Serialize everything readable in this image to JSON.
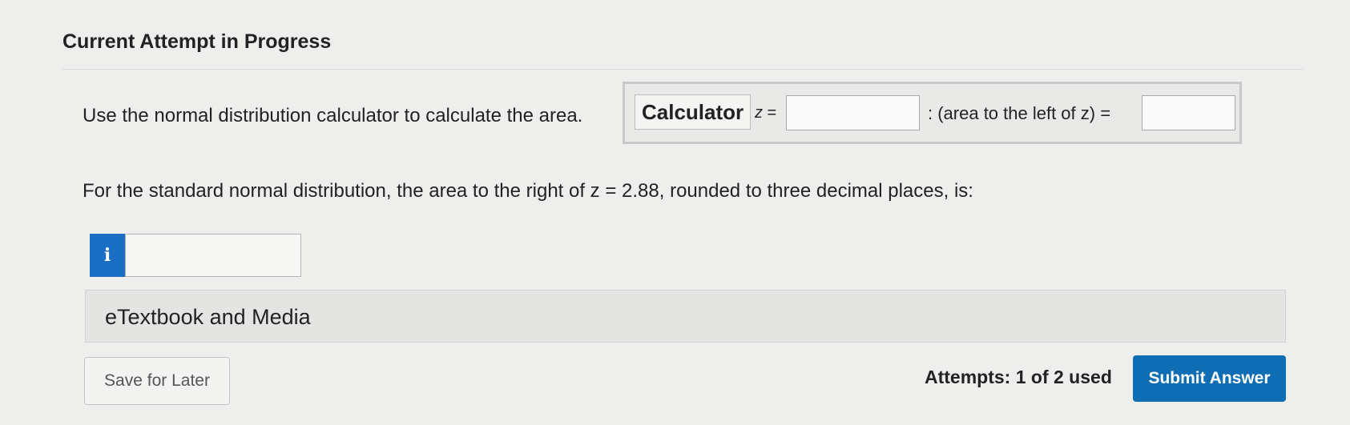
{
  "header": {
    "title": "Current Attempt in Progress"
  },
  "question": {
    "instruction": "Use the normal distribution calculator to calculate the area.",
    "calculator": {
      "button_label": "Calculator",
      "z_var": "z",
      "z_eq": " =",
      "z_value": "",
      "area_label": ": (area to the left of z) =",
      "area_value": ""
    },
    "prompt": "For the standard normal distribution, the area to the right of z = 2.88, rounded to three decimal places, is:",
    "answer": {
      "info_icon": "info-icon",
      "info_glyph": "i",
      "value": ""
    }
  },
  "etextbook": {
    "label": "eTextbook and Media"
  },
  "footer": {
    "save_label": "Save for Later",
    "attempts_text": "Attempts: 1 of 2 used",
    "submit_label": "Submit Answer"
  },
  "colors": {
    "accent": "#0f6db3",
    "info_badge": "#1a6fc4",
    "background": "#eeeeed"
  }
}
